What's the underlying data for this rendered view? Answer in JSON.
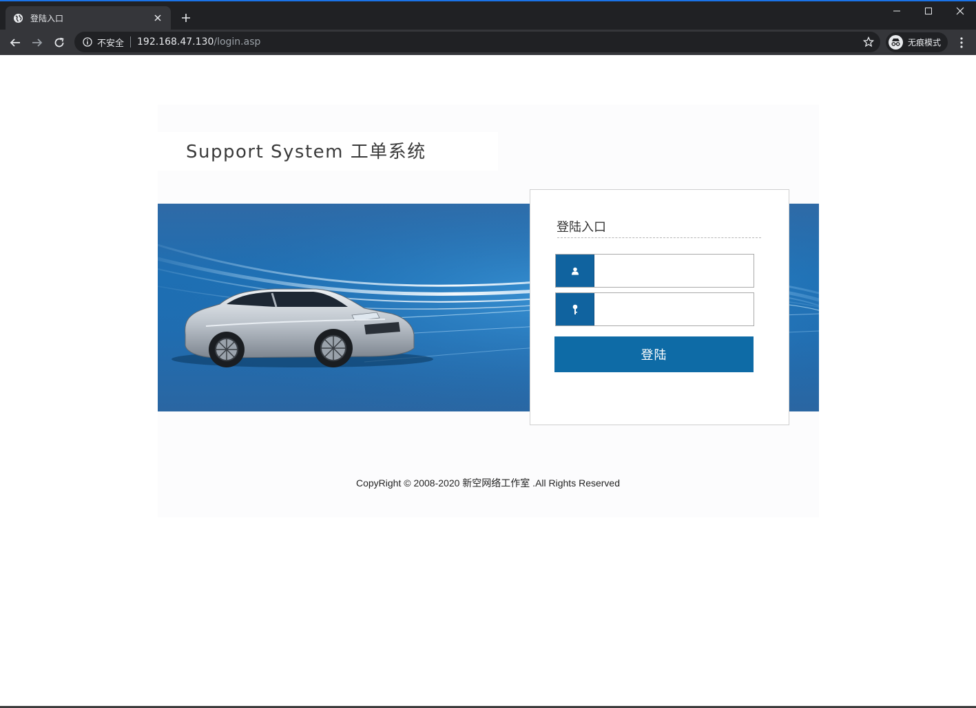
{
  "browser": {
    "tab_title": "登陆入口",
    "security_label": "不安全",
    "url_host": "192.168.47.130",
    "url_path": "/login.asp",
    "incognito_label": "无痕模式"
  },
  "page": {
    "site_title": "Support System 工单系统",
    "login": {
      "heading": "登陆入口",
      "username_value": "",
      "password_value": "",
      "submit_label": "登陆"
    },
    "footer": "CopyRight © 2008-2020 新空网络工作室 .All Rights Reserved"
  },
  "colors": {
    "chrome_dark": "#202124",
    "chrome_toolbar": "#35363a",
    "accent_blue": "#0e6ba6",
    "icon_block": "#10639f"
  },
  "icons": [
    "globe-icon",
    "close-icon",
    "plus-icon",
    "minimize-icon",
    "maximize-icon",
    "back-arrow-icon",
    "forward-arrow-icon",
    "reload-icon",
    "info-icon",
    "star-icon",
    "incognito-icon",
    "kebab-menu-icon",
    "user-icon",
    "key-icon"
  ]
}
